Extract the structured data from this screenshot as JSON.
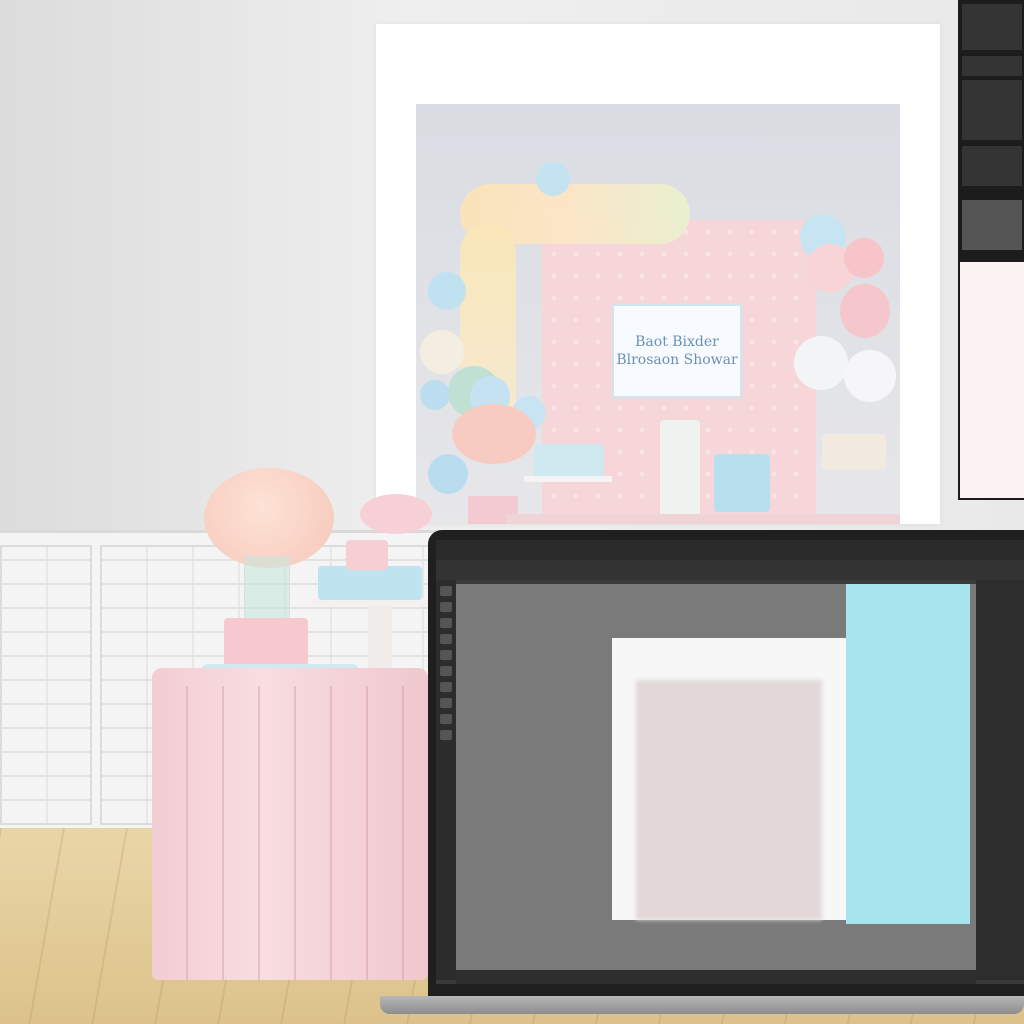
{
  "scene": {
    "description_free": true
  },
  "backdrop_sign": {
    "line1": "Baot Bixder",
    "line2": "Blrosaon Showar"
  },
  "laptop_app": {
    "menu_items": [
      "",
      "",
      "",
      "",
      "",
      "",
      "",
      "",
      "",
      ""
    ],
    "status": ""
  },
  "colors": {
    "table_pink": "#f4d2d7",
    "balloon_blue": "#bfe3ef",
    "balloon_pink": "#f7c9cf",
    "accent_cyan": "#a6e4ee",
    "floor_wood": "#e3cc95"
  }
}
